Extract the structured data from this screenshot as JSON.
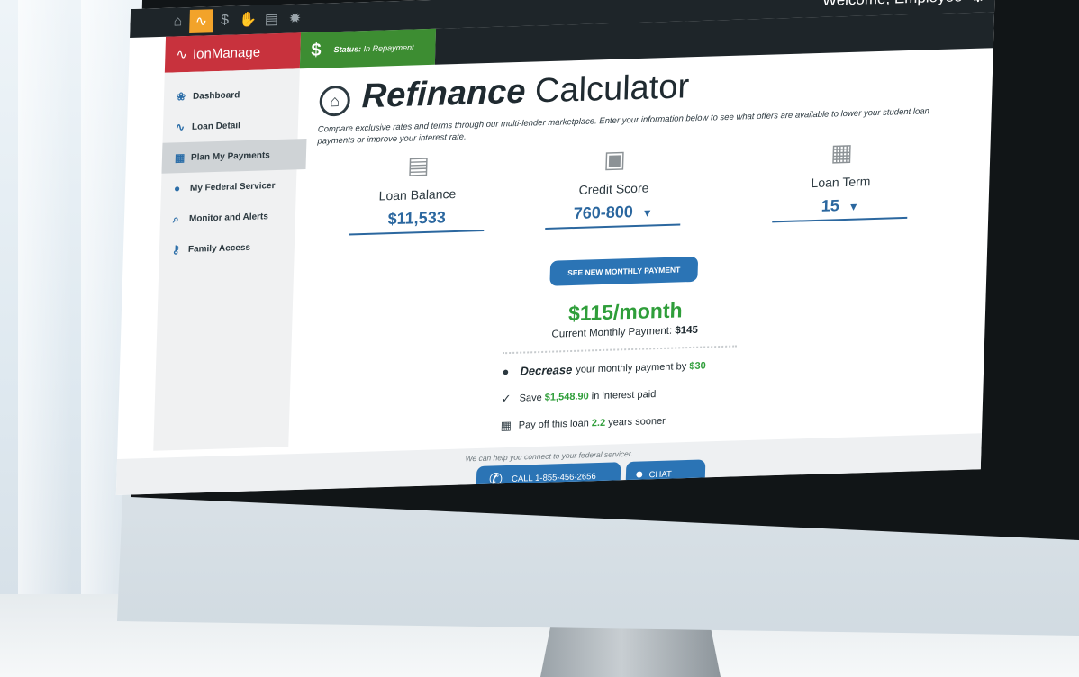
{
  "topbar": {
    "icons": [
      "graduation-icon",
      "pulse-icon",
      "money-icon",
      "hand-icon",
      "document-icon",
      "gear-icon"
    ],
    "welcome": "Welcome, Employee"
  },
  "brand": {
    "name": "IonManage"
  },
  "status": {
    "symbol": "$",
    "label": "Status:",
    "value": "In Repayment"
  },
  "sidebar": {
    "items": [
      {
        "label": "Dashboard",
        "icon": "dashboard-icon"
      },
      {
        "label": "Loan Detail",
        "icon": "pulse-icon"
      },
      {
        "label": "Plan My Payments",
        "icon": "calendar-icon"
      },
      {
        "label": "My Federal Servicer",
        "icon": "info-icon"
      },
      {
        "label": "Monitor and Alerts",
        "icon": "search-icon"
      },
      {
        "label": "Family Access",
        "icon": "key-icon"
      }
    ],
    "active_index": 2
  },
  "page": {
    "title_bold": "Refinance",
    "title_light": "Calculator",
    "description": "Compare exclusive rates and terms through our multi-lender marketplace. Enter your information below to see what offers are available to lower your student loan payments or improve your interest rate."
  },
  "fields": {
    "balance": {
      "label": "Loan Balance",
      "value": "$11,533",
      "icon": "document-icon"
    },
    "credit": {
      "label": "Credit Score",
      "value": "760-800",
      "icon": "credit-report-icon"
    },
    "term": {
      "label": "Loan Term",
      "value": "15",
      "icon": "calendar-dollar-icon"
    }
  },
  "action": {
    "label": "SEE NEW MONTHLY PAYMENT"
  },
  "result": {
    "monthly": "$115/month",
    "current_label": "Current Monthly Payment:",
    "current_value": "$145"
  },
  "benefits": {
    "decrease": {
      "strong": "Decrease",
      "text": "your monthly payment by",
      "amount": "$30",
      "icon": "piggy-bank-icon"
    },
    "save": {
      "pre": "Save",
      "amount": "$1,548.90",
      "post": "in interest paid",
      "icon": "check-badge-icon"
    },
    "payoff": {
      "pre": "Pay off this loan",
      "amount": "2.2",
      "post": "years sooner",
      "icon": "calendar-icon"
    }
  },
  "footer": {
    "help": "We can help you connect to your federal servicer.",
    "call": "CALL 1-855-456-2656",
    "chat": "CHAT"
  },
  "colors": {
    "accent_blue": "#2b74b5",
    "brand_red": "#c8323d",
    "status_green": "#3d8d32",
    "positive_green": "#2f9e3a",
    "tab_orange": "#f2a32a"
  }
}
